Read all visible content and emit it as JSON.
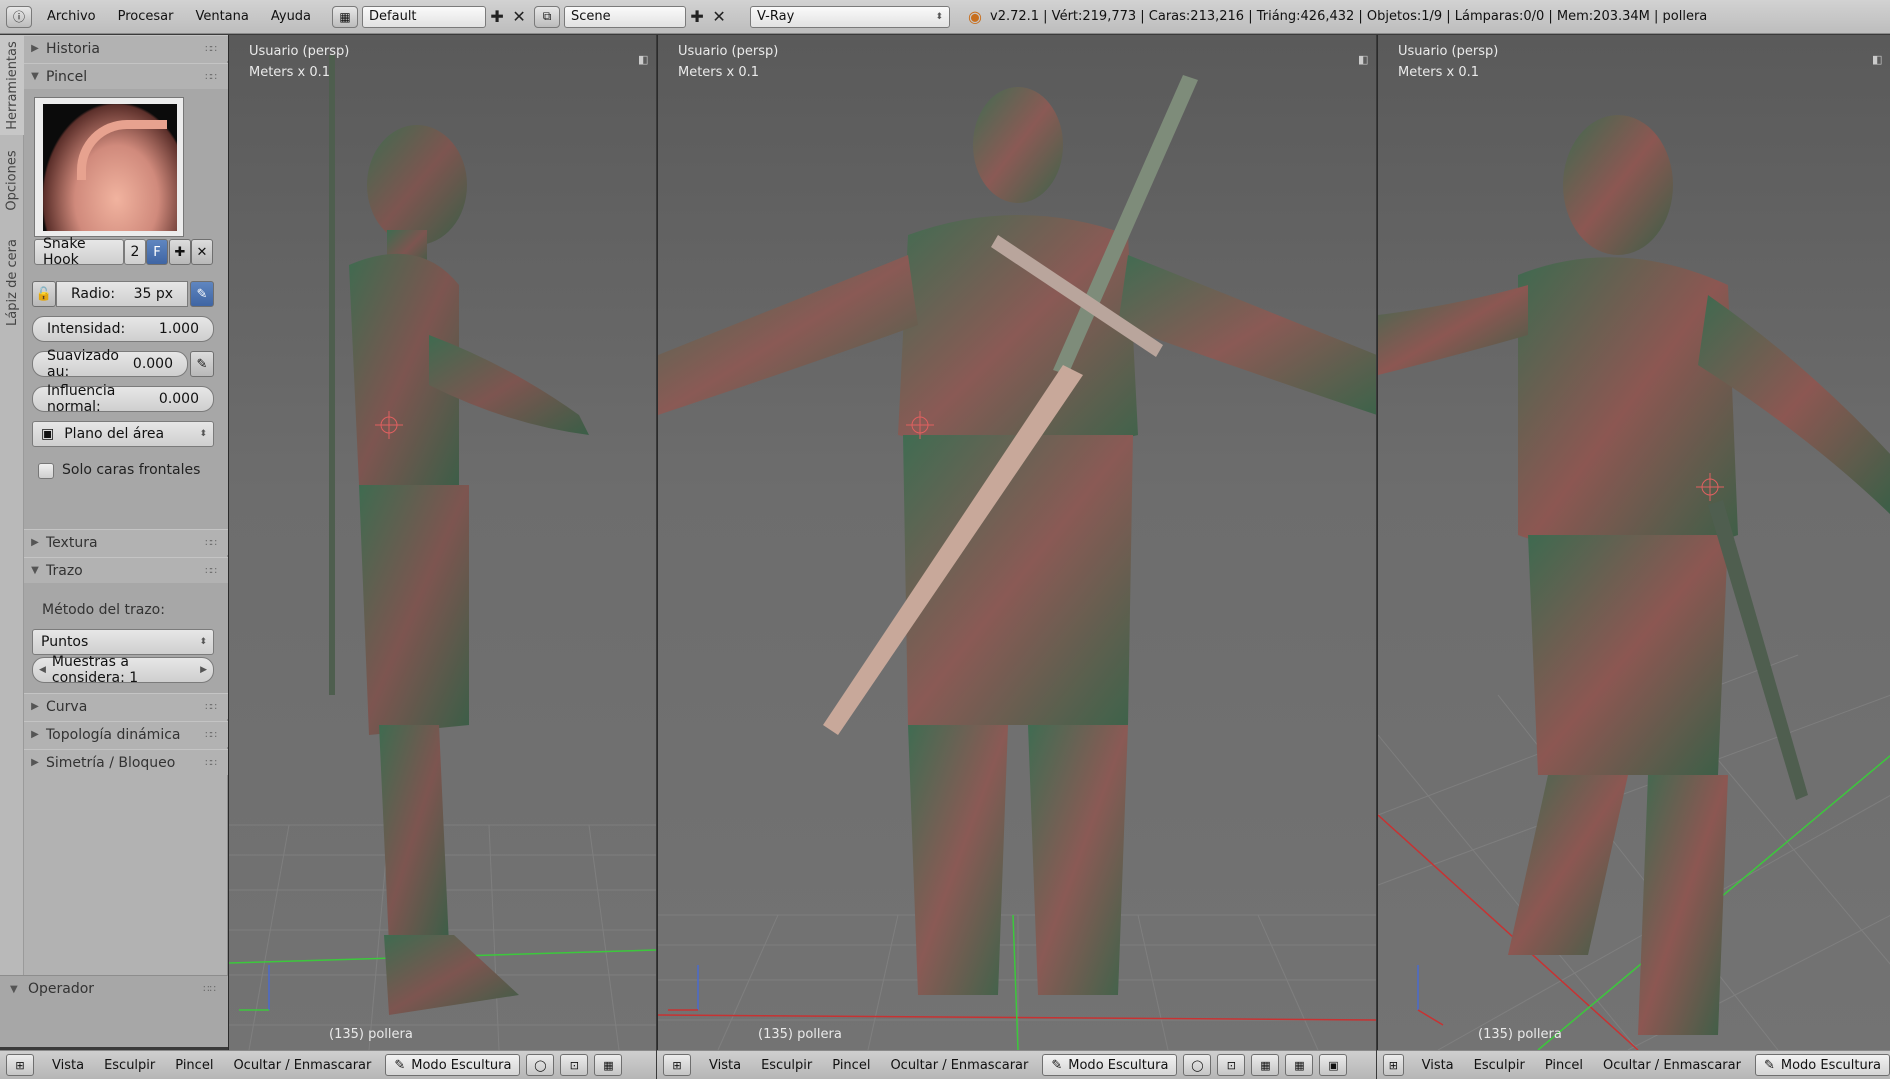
{
  "topbar": {
    "info_icon": "info-icon",
    "menus": [
      "Archivo",
      "Procesar",
      "Ventana",
      "Ayuda"
    ],
    "layout": "Default",
    "scene": "Scene",
    "engine": "V-Ray",
    "stats": "v2.72.1 | Vért:219,773 | Caras:213,216 | Triáng:426,432 | Objetos:1/9 | Lámparas:0/0 | Mem:203.34M | pollera"
  },
  "vtabs": [
    "Herramientas",
    "Opciones",
    "Lápiz de cera"
  ],
  "panels": {
    "historia": "Historia",
    "pincel": "Pincel",
    "brush_name": "Snake Hook",
    "brush_users": "2",
    "brush_fake": "F",
    "radio_label": "Radio:",
    "radio_value": "35 px",
    "intensidad_label": "Intensidad:",
    "intensidad_value": "1.000",
    "suavizado_label": "Suavizado au:",
    "suavizado_value": "0.000",
    "influencia_label": "Influencia normal:",
    "influencia_value": "0.000",
    "plano": "Plano del área",
    "solo_caras": "Solo caras frontales",
    "textura": "Textura",
    "trazo": "Trazo",
    "metodo_label": "Método del trazo:",
    "metodo_value": "Puntos",
    "muestras": "Muestras a considera: 1",
    "curva": "Curva",
    "topologia": "Topología dinámica",
    "simetria": "Simetría / Bloqueo",
    "operador": "Operador"
  },
  "viewports": [
    {
      "view": "Usuario (persp)",
      "scale": "Meters x 0.1",
      "object": "(135) pollera"
    },
    {
      "view": "Usuario (persp)",
      "scale": "Meters x 0.1",
      "object": "(135) pollera"
    },
    {
      "view": "Usuario (persp)",
      "scale": "Meters x 0.1",
      "object": "(135) pollera"
    }
  ],
  "bottombar": {
    "items": [
      "Vista",
      "Esculpir",
      "Pincel",
      "Ocultar / Enmascarar"
    ],
    "mode": "Modo Escultura"
  },
  "colors": {
    "viewport_bg": "#6a6a6a",
    "skin_green": "#3f6b50",
    "skin_red": "#8a5250",
    "grid": "#8b8b8b",
    "axis_x": "#c83232",
    "axis_y": "#3cc83c"
  }
}
